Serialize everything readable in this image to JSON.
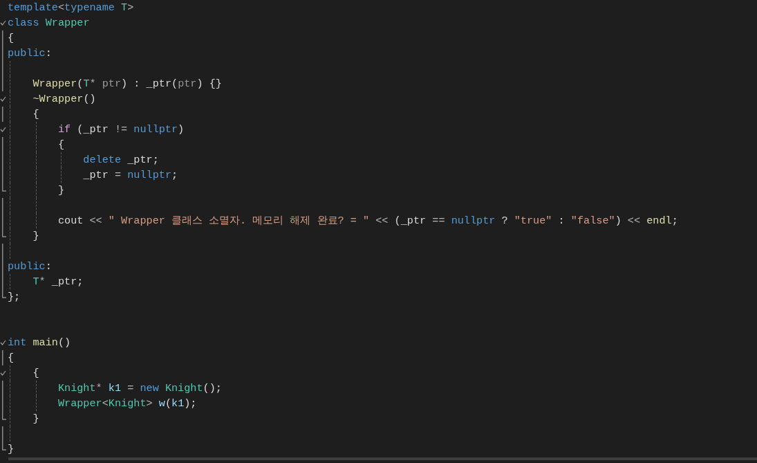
{
  "editor": {
    "lines": [
      {
        "kind": "plain",
        "tokens": [
          {
            "kind": "kw",
            "text": "template"
          },
          {
            "kind": "op",
            "text": "<"
          },
          {
            "kind": "kw",
            "text": "typename"
          },
          {
            "kind": "type",
            "text": " T"
          },
          {
            "kind": "op",
            "text": ">"
          }
        ]
      },
      {
        "kind": "fold-start",
        "tokens": [
          {
            "kind": "kw",
            "text": "class"
          },
          {
            "kind": "type",
            "text": " Wrapper"
          }
        ]
      },
      {
        "kind": "fold-inner",
        "tokens": [
          {
            "kind": "plain",
            "text": "{"
          }
        ]
      },
      {
        "kind": "fold-inner",
        "tokens": [
          {
            "kind": "kw",
            "text": "public"
          },
          {
            "kind": "plain",
            "text": ":"
          }
        ]
      },
      {
        "kind": "fold-inner"
      },
      {
        "kind": "fold-inner",
        "tokens": [
          {
            "kind": "fn",
            "text": "    Wrapper"
          },
          {
            "kind": "plain",
            "text": "("
          },
          {
            "kind": "type",
            "text": "T"
          },
          {
            "kind": "op",
            "text": "*"
          },
          {
            "kind": "param",
            "text": " ptr"
          },
          {
            "kind": "plain",
            "text": ") : _ptr("
          },
          {
            "kind": "param",
            "text": "ptr"
          },
          {
            "kind": "plain",
            "text": ") {}"
          }
        ]
      },
      {
        "kind": "fold-start",
        "tokens": [
          {
            "kind": "fn",
            "text": "    ~Wrapper"
          },
          {
            "kind": "plain",
            "text": "()"
          }
        ]
      },
      {
        "kind": "fold-inner",
        "tokens": [
          {
            "kind": "plain",
            "text": "    {"
          }
        ]
      },
      {
        "kind": "fold-start",
        "tokens": [
          {
            "kind": "ctl",
            "text": "        if"
          },
          {
            "kind": "plain",
            "text": " (_ptr "
          },
          {
            "kind": "op",
            "text": "!="
          },
          {
            "kind": "kw",
            "text": " nullptr"
          },
          {
            "kind": "plain",
            "text": ")"
          }
        ]
      },
      {
        "kind": "fold-inner",
        "tokens": [
          {
            "kind": "plain",
            "text": "        {"
          }
        ]
      },
      {
        "kind": "fold-inner",
        "tokens": [
          {
            "kind": "kw",
            "text": "            delete"
          },
          {
            "kind": "plain",
            "text": " _ptr;"
          }
        ]
      },
      {
        "kind": "fold-inner",
        "tokens": [
          {
            "kind": "plain",
            "text": "            _ptr "
          },
          {
            "kind": "op",
            "text": "="
          },
          {
            "kind": "kw",
            "text": " nullptr"
          },
          {
            "kind": "plain",
            "text": ";"
          }
        ]
      },
      {
        "kind": "fold-end",
        "tokens": [
          {
            "kind": "plain",
            "text": "        }"
          }
        ]
      },
      {
        "kind": "fold-inner"
      },
      {
        "kind": "fold-inner",
        "tokens": [
          {
            "kind": "plain",
            "text": "        cout "
          },
          {
            "kind": "op",
            "text": "<<"
          },
          {
            "kind": "str",
            "text": " \" Wrapper 클래스 소멸자. 메모리 해제 완료? = \""
          },
          {
            "kind": "op",
            "text": " <<"
          },
          {
            "kind": "plain",
            "text": " (_ptr "
          },
          {
            "kind": "op",
            "text": "=="
          },
          {
            "kind": "kw",
            "text": " nullptr"
          },
          {
            "kind": "plain",
            "text": " ? "
          },
          {
            "kind": "str",
            "text": "\"true\""
          },
          {
            "kind": "plain",
            "text": " : "
          },
          {
            "kind": "str",
            "text": "\"false\""
          },
          {
            "kind": "plain",
            "text": ") "
          },
          {
            "kind": "op",
            "text": "<<"
          },
          {
            "kind": "fn",
            "text": " endl"
          },
          {
            "kind": "plain",
            "text": ";"
          }
        ]
      },
      {
        "kind": "fold-end",
        "tokens": [
          {
            "kind": "plain",
            "text": "    }"
          }
        ]
      },
      {
        "kind": "fold-inner"
      },
      {
        "kind": "fold-inner",
        "tokens": [
          {
            "kind": "kw",
            "text": "public"
          },
          {
            "kind": "plain",
            "text": ":"
          }
        ]
      },
      {
        "kind": "fold-inner",
        "tokens": [
          {
            "kind": "type",
            "text": "    T"
          },
          {
            "kind": "op",
            "text": "*"
          },
          {
            "kind": "plain",
            "text": " _ptr;"
          }
        ]
      },
      {
        "kind": "fold-end",
        "tokens": [
          {
            "kind": "plain",
            "text": "};"
          }
        ]
      },
      {
        "kind": "plain"
      },
      {
        "kind": "plain"
      },
      {
        "kind": "fold-start",
        "tokens": [
          {
            "kind": "kw",
            "text": "int"
          },
          {
            "kind": "fn",
            "text": " main"
          },
          {
            "kind": "plain",
            "text": "()"
          }
        ]
      },
      {
        "kind": "fold-inner",
        "tokens": [
          {
            "kind": "plain",
            "text": "{"
          }
        ]
      },
      {
        "kind": "fold-start",
        "tokens": [
          {
            "kind": "plain",
            "text": "    {"
          }
        ]
      },
      {
        "kind": "fold-inner",
        "tokens": [
          {
            "kind": "type",
            "text": "        Knight"
          },
          {
            "kind": "op",
            "text": "*"
          },
          {
            "kind": "var",
            "text": " k1"
          },
          {
            "kind": "op",
            "text": " ="
          },
          {
            "kind": "kw",
            "text": " new"
          },
          {
            "kind": "type",
            "text": " Knight"
          },
          {
            "kind": "plain",
            "text": "();"
          }
        ]
      },
      {
        "kind": "fold-inner",
        "tokens": [
          {
            "kind": "type",
            "text": "        Wrapper"
          },
          {
            "kind": "op",
            "text": "<"
          },
          {
            "kind": "type",
            "text": "Knight"
          },
          {
            "kind": "op",
            "text": ">"
          },
          {
            "kind": "var",
            "text": " w"
          },
          {
            "kind": "plain",
            "text": "("
          },
          {
            "kind": "var",
            "text": "k1"
          },
          {
            "kind": "plain",
            "text": ");"
          }
        ]
      },
      {
        "kind": "fold-end",
        "tokens": [
          {
            "kind": "plain",
            "text": "    }"
          }
        ]
      },
      {
        "kind": "fold-inner"
      },
      {
        "kind": "fold-end",
        "tokens": [
          {
            "kind": "plain",
            "text": "}"
          }
        ]
      }
    ]
  }
}
